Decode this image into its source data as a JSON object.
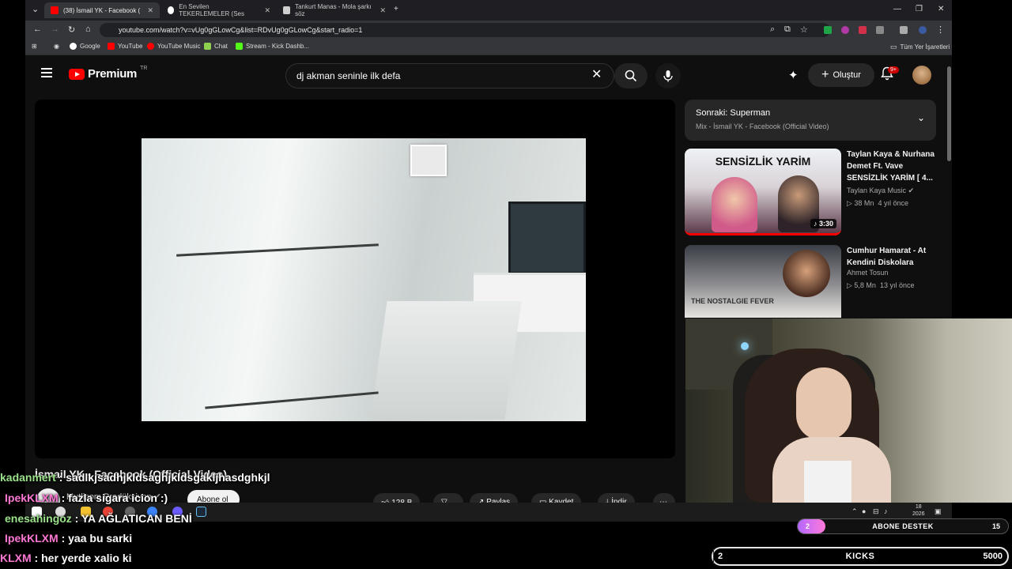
{
  "browser": {
    "tabs": [
      {
        "label": "(38) İsmail YK - Facebook (",
        "active": true,
        "fav_color": "#ff0000"
      },
      {
        "label": "En Sevilen TEKERLEMELER (Ses",
        "active": false,
        "fav_color": "#ffffff"
      },
      {
        "label": "Tankurt Manas - Mola şarkı söz",
        "active": false,
        "fav_color": "#ffffff"
      }
    ],
    "url": "youtube.com/watch?v=vUg0gGLowCg&list=RDvUg0gGLowCg&start_radio=1",
    "bookmarks": [
      "Google",
      "YouTube",
      "YouTube Music",
      "Chat",
      "Stream - Kick Dashb..."
    ],
    "bookmarks_right": "Tüm Yer İşaretleri"
  },
  "youtube": {
    "logo_text": "Premium",
    "logo_country": "TR",
    "search_query": "dj akman seninle ilk defa",
    "create_label": "Oluştur",
    "notif_count": "9+",
    "up_next_title": "Sonraki: Superman",
    "up_next_sub": "Mix - İsmail YK - Facebook (Official Video)",
    "video_title": "İsmail YK - Facebook (Official Video)",
    "channel": "Mutlicom Prodüksiyon",
    "subscribe_label": "Abone ol",
    "actions": {
      "likes": "128 B",
      "share": "Paylaş",
      "save": "Kaydet",
      "download": "İndir"
    },
    "recommendations": [
      {
        "title": "Taylan Kaya & Nurhana Demet Ft. Vave SENSİZLİK YARİM [ 4...",
        "channel": "Taylan Kaya Music",
        "views": "38 Mn",
        "age": "4 yıl önce",
        "duration": "3:30",
        "thumb_text": "SENSİZLİK YARİM"
      },
      {
        "title": "Cumhur Hamarat - At Kendini Diskolara",
        "channel": "Ahmet Tosun",
        "views": "5,8 Mn",
        "age": "13 yıl önce",
        "duration": "",
        "thumb_text": "THE NOSTALGIE FEVER"
      }
    ]
  },
  "taskbar": {
    "date": "18",
    "year": "2026"
  },
  "chat": [
    {
      "user": "kadanmert",
      "message": "sadlkjsadhjkldsaghjkldsgakljhasdghkjl",
      "color": "green"
    },
    {
      "user": "IpekKLXM",
      "message": "fazla sigara icion :)",
      "color": "pink"
    },
    {
      "user": "enesahingoz",
      "message": "YA AĞLATICAN BENİ",
      "color": "green"
    },
    {
      "user": "IpekKLXM",
      "message": "yaa bu sarki",
      "color": "pink"
    },
    {
      "user": "KLXM",
      "message": "her yerde xalio ki",
      "color": "pink"
    }
  ],
  "goals": {
    "subscriber": {
      "current": "2",
      "label": "ABONE DESTEK",
      "target": "15",
      "progress": 0.13
    },
    "kicks": {
      "current": "2",
      "label": "KICKS",
      "target": "5000",
      "progress": 0.0004
    }
  }
}
